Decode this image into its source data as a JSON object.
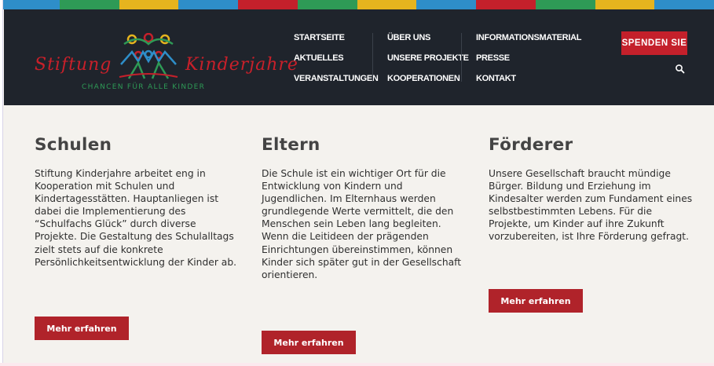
{
  "stripe_colors": [
    "#2e8ec9",
    "#2e9a56",
    "#e6b41e",
    "#2e8ec9",
    "#c4202b",
    "#2e9a56",
    "#e6b41e",
    "#2e8ec9",
    "#c4202b",
    "#2e9a56",
    "#e6b41e",
    "#2e8ec9"
  ],
  "brand": {
    "name_left": "Stiftung",
    "name_right": "Kinderjahre",
    "tagline": "CHANCEN FÜR ALLE KINDER",
    "logo_icon": "children-figures-icon"
  },
  "nav": {
    "columns": [
      [
        "STARTSEITE",
        "AKTUELLES",
        "VERANSTALTUNGEN"
      ],
      [
        "ÜBER UNS",
        "UNSERE PROJEKTE",
        "KOOPERATIONEN"
      ],
      [
        "INFORMATIONSMATERIAL",
        "PRESSE",
        "KONTAKT"
      ]
    ],
    "active": "STARTSEITE"
  },
  "donate_label": "SPENDEN SIE",
  "search_icon": "search-icon",
  "colors": {
    "header_bg": "#1f242c",
    "accent_red": "#c4202b",
    "button_red": "#b0232a",
    "content_bg": "#f4f2ee"
  },
  "sections": [
    {
      "title": "Schulen",
      "text": "Stiftung Kinderjahre arbeitet eng in Kooperation mit Schulen und Kindertagesstätten. Hauptanliegen ist dabei die Implementierung des “Schulfachs Glück” durch diverse Projekte. Die Gestaltung des Schulalltags zielt stets auf die konkrete Persönlichkeitsentwicklung der Kinder ab.",
      "button": "Mehr erfahren"
    },
    {
      "title": "Eltern",
      "text": "Die Schule ist ein wichtiger Ort für die Entwicklung von Kindern und Jugendlichen. Im Elternhaus werden grundlegende Werte vermittelt, die den Menschen sein Leben lang begleiten. Wenn die Leitideen der prägenden Einrichtungen übereinstimmen, können Kinder sich später gut in der Gesellschaft orientieren.",
      "button": "Mehr erfahren"
    },
    {
      "title": "Förderer",
      "text": "Unsere Gesellschaft braucht mündige Bürger. Bildung und Erziehung im Kindesalter werden zum Fundament eines selbstbestimmten Lebens. Für die Projekte, um Kinder auf ihre Zukunft vorzubereiten, ist Ihre Förderung gefragt.",
      "button": "Mehr erfahren"
    }
  ]
}
